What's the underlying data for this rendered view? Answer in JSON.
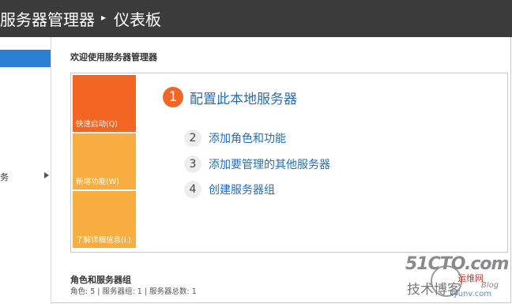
{
  "window": {
    "title": "服务器管理器",
    "separator": "▸",
    "page": "仪表板"
  },
  "sidebar": {
    "partial_label": "务"
  },
  "welcome": {
    "title": "欢迎使用服务器管理器",
    "tiles": [
      {
        "label": "快速启动(Q)"
      },
      {
        "label": "新增功能(W)"
      },
      {
        "label": "了解详细信息(L)"
      }
    ],
    "steps": [
      {
        "num": "1",
        "label": "配置此本地服务器"
      },
      {
        "num": "2",
        "label": "添加角色和功能"
      },
      {
        "num": "3",
        "label": "添加要管理的其他服务器"
      },
      {
        "num": "4",
        "label": "创建服务器组"
      }
    ]
  },
  "roles": {
    "title": "角色和服务器组",
    "summary": "角色: 5 | 服务器组: 1 | 服务器总数: 1"
  },
  "watermark": {
    "site": "51CTO.com",
    "sub": "技术博客",
    "tag": "运维网",
    "blog": "Blog",
    "url": "iyunv.com"
  },
  "colors": {
    "titlebar": "#3b3b3b",
    "accent_orange": "#f26522",
    "tile_light": "#f7ad3f",
    "link_blue": "#1f6fbf",
    "sidebar_active": "#2a7fd4"
  }
}
